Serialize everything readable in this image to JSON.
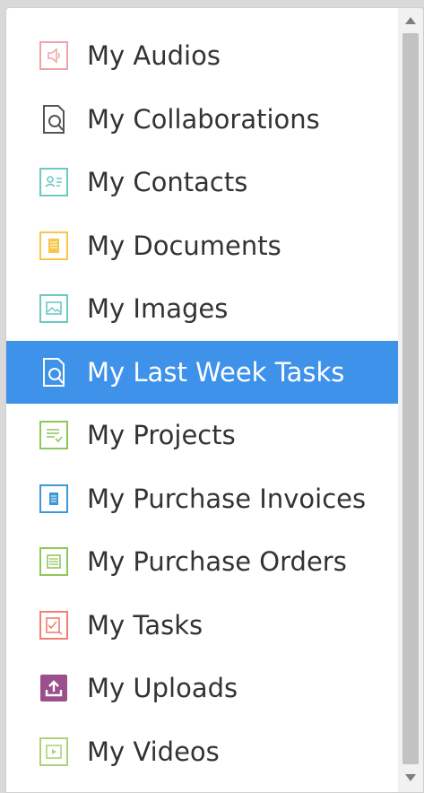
{
  "menu": {
    "selected_index": 5,
    "items": [
      {
        "label": "My Audios",
        "icon": "audio-icon",
        "color": "#f0a3a8"
      },
      {
        "label": "My Collaborations",
        "icon": "collaboration-icon",
        "color": "#555555"
      },
      {
        "label": "My Contacts",
        "icon": "contacts-icon",
        "color": "#6cc9c4"
      },
      {
        "label": "My Documents",
        "icon": "document-icon",
        "color": "#f7c64a"
      },
      {
        "label": "My Images",
        "icon": "image-icon",
        "color": "#6cc9c4"
      },
      {
        "label": "My Last Week Tasks",
        "icon": "last-week-tasks-icon",
        "color": "#ffffff"
      },
      {
        "label": "My Projects",
        "icon": "projects-icon",
        "color": "#8dc85b"
      },
      {
        "label": "My Purchase Invoices",
        "icon": "purchase-invoice-icon",
        "color": "#3c99d6"
      },
      {
        "label": "My Purchase Orders",
        "icon": "purchase-order-icon",
        "color": "#8dc85b"
      },
      {
        "label": "My Tasks",
        "icon": "tasks-icon",
        "color": "#f27f6e"
      },
      {
        "label": "My Uploads",
        "icon": "upload-icon",
        "color": "#9c4f8d"
      },
      {
        "label": "My Videos",
        "icon": "video-icon",
        "color": "#aed27b"
      }
    ]
  },
  "colors": {
    "selection": "#3f92ea",
    "text": "#333333"
  }
}
